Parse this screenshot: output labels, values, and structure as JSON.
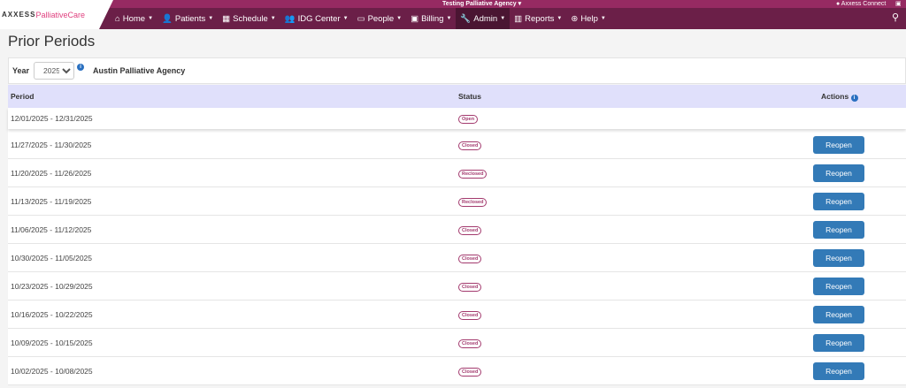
{
  "header": {
    "agency": "Testing Palliative Agency",
    "connect": "Axxess Connect",
    "logo_brand": "AXXESS",
    "logo_product": "PalliativeCare",
    "menu": [
      {
        "icon": "home-icon",
        "glyph": "⌂",
        "label": "Home"
      },
      {
        "icon": "user-icon",
        "glyph": "👤",
        "label": "Patients"
      },
      {
        "icon": "calendar-icon",
        "glyph": "▦",
        "label": "Schedule"
      },
      {
        "icon": "users-icon",
        "glyph": "👥",
        "label": "IDG Center"
      },
      {
        "icon": "id-card-icon",
        "glyph": "▭",
        "label": "People"
      },
      {
        "icon": "money-icon",
        "glyph": "▣",
        "label": "Billing"
      },
      {
        "icon": "wrench-icon",
        "glyph": "🔧",
        "label": "Admin",
        "active": true
      },
      {
        "icon": "chart-icon",
        "glyph": "▥",
        "label": "Reports"
      },
      {
        "icon": "life-ring-icon",
        "glyph": "⊛",
        "label": "Help"
      }
    ]
  },
  "page": {
    "title": "Prior Periods"
  },
  "filter": {
    "year_label": "Year",
    "year_value": "2025",
    "agency": "Austin Palliative Agency"
  },
  "table": {
    "headers": {
      "period": "Period",
      "status": "Status",
      "actions": "Actions"
    },
    "rows": [
      {
        "period": "12/01/2025 - 12/31/2025",
        "status": "Open",
        "action": ""
      },
      {
        "period": "11/27/2025 - 11/30/2025",
        "status": "Closed",
        "action": "Reopen"
      },
      {
        "period": "11/20/2025 - 11/26/2025",
        "status": "Reclosed",
        "action": "Reopen"
      },
      {
        "period": "11/13/2025 - 11/19/2025",
        "status": "Reclosed",
        "action": "Reopen"
      },
      {
        "period": "11/06/2025 - 11/12/2025",
        "status": "Closed",
        "action": "Reopen"
      },
      {
        "period": "10/30/2025 - 11/05/2025",
        "status": "Closed",
        "action": "Reopen"
      },
      {
        "period": "10/23/2025 - 10/29/2025",
        "status": "Closed",
        "action": "Reopen"
      },
      {
        "period": "10/16/2025 - 10/22/2025",
        "status": "Closed",
        "action": "Reopen"
      },
      {
        "period": "10/09/2025 - 10/15/2025",
        "status": "Closed",
        "action": "Reopen"
      },
      {
        "period": "10/02/2025 - 10/08/2025",
        "status": "Closed",
        "action": "Reopen"
      }
    ]
  }
}
